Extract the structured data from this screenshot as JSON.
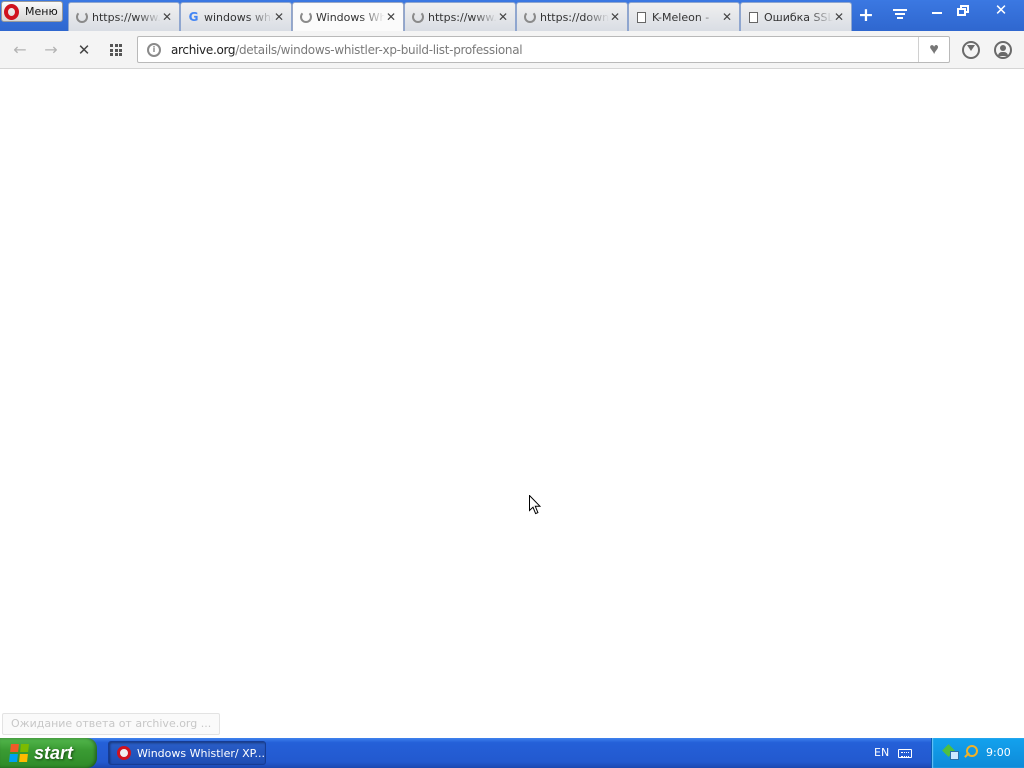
{
  "browser": {
    "menu_label": "Меню",
    "tabs": [
      {
        "title": "https://www.",
        "icon": "loading-spinner-icon"
      },
      {
        "title": "windows whistler",
        "icon": "google-g-icon"
      },
      {
        "title": "Windows Whistler",
        "icon": "loading-spinner-icon",
        "active": true
      },
      {
        "title": "https://www.",
        "icon": "loading-spinner-icon"
      },
      {
        "title": "https://download",
        "icon": "loading-spinner-icon"
      },
      {
        "title": "K-Meleon - ",
        "icon": "page-icon"
      },
      {
        "title": "Ошибка SSL",
        "icon": "page-icon"
      }
    ],
    "tab_close_glyph": "✕",
    "new_tab_glyph": "+",
    "google_glyph": "G"
  },
  "navigation": {
    "back_glyph": "←",
    "forward_glyph": "→",
    "stop_glyph": "✕",
    "address_info_glyph": "i",
    "address_host": "archive.org",
    "address_path": "/details/windows-whistler-xp-build-list-professional",
    "bookmark_glyph": "♥"
  },
  "page": {
    "status_text": "Ожидание ответа от archive.org ..."
  },
  "taskbar": {
    "start_label": "start",
    "task_title": "Windows Whistler/ XP...",
    "language": "EN",
    "clock": "9:00"
  },
  "colors": {
    "title_bar": "#3b78e2",
    "opera_red": "#d0121e",
    "start_green": "#3a9b33",
    "taskbar_blue": "#2359cf",
    "tray_blue": "#13a2ee"
  }
}
